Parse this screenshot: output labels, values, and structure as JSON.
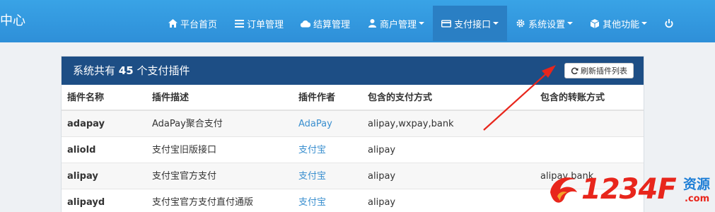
{
  "brand": "中心",
  "nav": [
    {
      "label": "平台首页",
      "icon": "home-icon",
      "dropdown": false,
      "active": false
    },
    {
      "label": "订单管理",
      "icon": "list-icon",
      "dropdown": false,
      "active": false
    },
    {
      "label": "结算管理",
      "icon": "cloud-icon",
      "dropdown": false,
      "active": false
    },
    {
      "label": "商户管理",
      "icon": "user-icon",
      "dropdown": true,
      "active": false
    },
    {
      "label": "支付接口",
      "icon": "credit-card-icon",
      "dropdown": true,
      "active": true
    },
    {
      "label": "系统设置",
      "icon": "gear-icon",
      "dropdown": true,
      "active": false
    },
    {
      "label": "其他功能",
      "icon": "cube-icon",
      "dropdown": true,
      "active": false
    }
  ],
  "panel": {
    "title_prefix": "系统共有",
    "count": "45",
    "title_suffix": "个支付插件",
    "refresh_label": "刷新插件列表"
  },
  "table": {
    "headers": [
      "插件名称",
      "插件描述",
      "插件作者",
      "包含的支付方式",
      "包含的转账方式"
    ],
    "rows": [
      {
        "name": "adapay",
        "desc": "AdaPay聚合支付",
        "author": "AdaPay",
        "pay": "alipay,wxpay,bank",
        "transfer": ""
      },
      {
        "name": "aliold",
        "desc": "支付宝旧版接口",
        "author": "支付宝",
        "pay": "alipay",
        "transfer": ""
      },
      {
        "name": "alipay",
        "desc": "支付宝官方支付",
        "author": "支付宝",
        "pay": "alipay",
        "transfer": "alipay,bank"
      },
      {
        "name": "alipayd",
        "desc": "支付宝官方支付直付通版",
        "author": "支付宝",
        "pay": "alipay",
        "transfer": ""
      }
    ]
  },
  "watermark": {
    "text": "1234F",
    "zh": "资源",
    "suffix": ".com"
  },
  "colors": {
    "navbar": "#2e8fd8",
    "panel_header": "#1d4e85",
    "link": "#3a8fcf",
    "arrow": "#e8261c"
  }
}
